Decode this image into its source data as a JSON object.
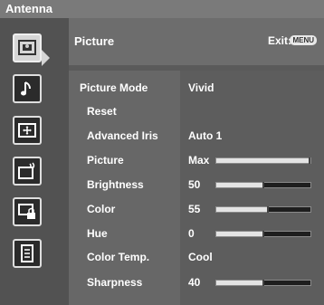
{
  "header": {
    "source": "Antenna",
    "section_title": "Picture",
    "exit_label": "Exit:",
    "exit_key": "MENU"
  },
  "sidebar": {
    "icons": [
      "picture-icon",
      "music-note-icon",
      "screen-adjust-icon",
      "tv-setup-icon",
      "lock-icon",
      "list-icon"
    ]
  },
  "settings": [
    {
      "label": "Picture Mode",
      "value": "Vivid"
    },
    {
      "label": "Reset",
      "value": ""
    },
    {
      "label": "Advanced Iris",
      "value": "Auto 1"
    },
    {
      "label": "Picture",
      "value": "Max",
      "level": 1.0
    },
    {
      "label": "Brightness",
      "value": "50",
      "level": 0.5
    },
    {
      "label": "Color",
      "value": "55",
      "level": 0.55
    },
    {
      "label": "Hue",
      "value": "0",
      "level": 0.5
    },
    {
      "label": "Color Temp.",
      "value": "Cool"
    },
    {
      "label": "Sharpness",
      "value": "40",
      "level": 0.5
    }
  ]
}
